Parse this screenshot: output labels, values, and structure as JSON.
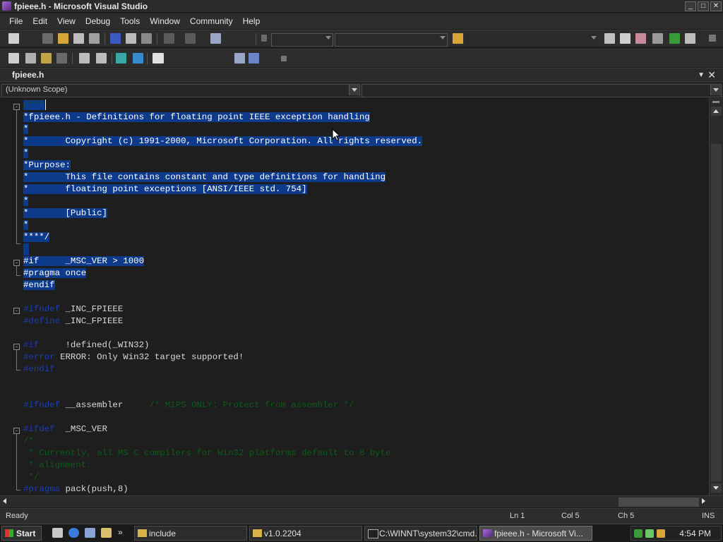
{
  "window": {
    "title": "fpieee.h - Microsoft Visual Studio",
    "controls": [
      "_",
      "□",
      "✕"
    ]
  },
  "menu": [
    "File",
    "Edit",
    "View",
    "Debug",
    "Tools",
    "Window",
    "Community",
    "Help"
  ],
  "document_tab": {
    "label": "fpieee.h",
    "dropdown_glyph": "▼",
    "close_glyph": "✕"
  },
  "scope_bar": {
    "left_value": "(Unknown Scope)",
    "right_value": ""
  },
  "code_lines": [
    "/***",
    "*fpieee.h - Definitions for floating point IEEE exception handling",
    "*",
    "*       Copyright (c) 1991-2000, Microsoft Corporation. All rights reserved.",
    "*",
    "*Purpose:",
    "*       This file contains constant and type definitions for handling",
    "*       floating point exceptions [ANSI/IEEE std. 754]",
    "*",
    "*       [Public]",
    "*",
    "****/",
    "",
    "#if     _MSC_VER > 1000",
    "#pragma once",
    "#endif",
    "",
    "#ifndef _INC_FPIEEE",
    "#define _INC_FPIEEE",
    "",
    "#if     !defined(_WIN32)",
    "#error ERROR: Only Win32 target supported!",
    "#endif",
    "",
    "",
    "#ifndef __assembler     /* MIPS ONLY: Protect from assembler */",
    "",
    "#ifdef  _MSC_VER",
    "/*",
    " * Currently, all MS C compilers for Win32 platforms default to 8 byte",
    " * alignment.",
    " */",
    "#pragma pack(push,8)"
  ],
  "status_bar": {
    "state": "Ready",
    "line": "Ln 1",
    "column": "Col 5",
    "char": "Ch 5",
    "mode": "INS"
  },
  "taskbar": {
    "start_label": "Start",
    "tasks": [
      {
        "label": "include"
      },
      {
        "label": "v1.0.2204"
      },
      {
        "label": "C:\\WINNT\\system32\\cmd...."
      },
      {
        "label": "fpieee.h - Microsoft Vi..."
      }
    ],
    "clock": "4:54 PM"
  },
  "colors": {
    "selection": "#0e3a8c",
    "keyword": "#1a3fb0",
    "comment": "#0e5a1a"
  }
}
